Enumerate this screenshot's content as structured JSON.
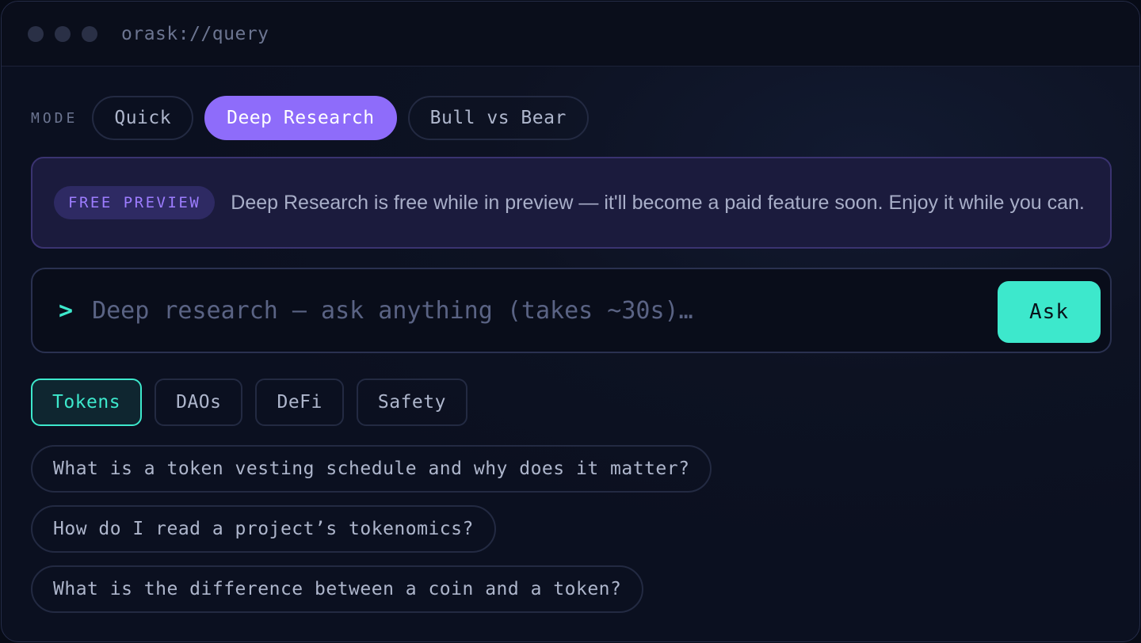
{
  "window": {
    "url": "orask://query"
  },
  "mode": {
    "label": "MODE",
    "options": [
      "Quick",
      "Deep Research",
      "Bull vs Bear"
    ],
    "selected": "Deep Research"
  },
  "banner": {
    "badge": "FREE PREVIEW",
    "text": "Deep Research is free while in preview — it'll become a paid feature soon. Enjoy it while you can."
  },
  "search": {
    "prompt_symbol": ">",
    "placeholder": "Deep research — ask anything (takes ~30s)…",
    "value": "",
    "ask_label": "Ask"
  },
  "categories": {
    "items": [
      "Tokens",
      "DAOs",
      "DeFi",
      "Safety"
    ],
    "selected": "Tokens"
  },
  "suggestions": [
    "What is a token vesting schedule and why does it matter?",
    "How do I read a project’s tokenomics?",
    "What is the difference between a coin and a token?"
  ],
  "colors": {
    "accent_purple": "#8e6cfa",
    "accent_teal": "#3de8cc",
    "background": "#0b1020"
  }
}
